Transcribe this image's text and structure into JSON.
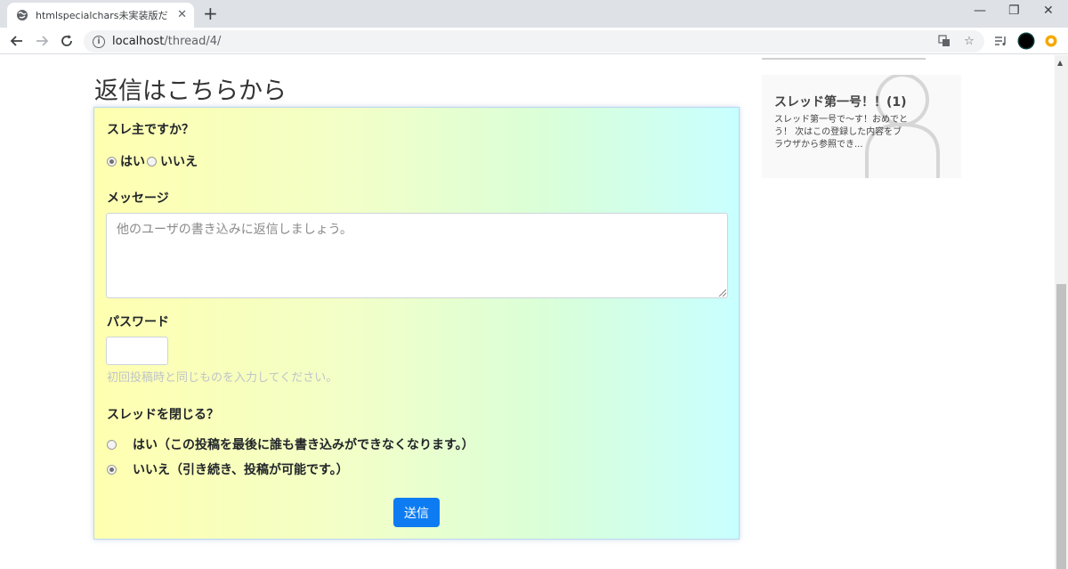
{
  "browser": {
    "tab_title": "htmlspecialchars未実装版だヒ",
    "url_host": "localhost",
    "url_path": "/thread/4/"
  },
  "page": {
    "heading": "返信はこちらから"
  },
  "form": {
    "owner_question": "スレ主ですか？",
    "owner_yes": "はい",
    "owner_no": "いいえ",
    "owner_selected": "yes",
    "message_label": "メッセージ",
    "message_placeholder": "他のユーザの書き込みに返信しましょう。",
    "password_label": "パスワード",
    "password_help": "初回投稿時と同じものを入力してください。",
    "close_question": "スレッドを閉じる？",
    "close_yes": "はい（この投稿を最後に誰も書き込みができなくなります。）",
    "close_no": "いいえ（引き続き、投稿が可能です。）",
    "close_selected": "no",
    "submit_label": "送信"
  },
  "sidebar": {
    "thread_title": "スレッド第一号！！(1)",
    "thread_snippet": "スレッド第一号で～す！おめでとう！ 次はこの登録した内容をブラウザから参照でき..."
  },
  "colors": {
    "accent": "#0d7cf2",
    "gradient_left": "#ffffb0",
    "gradient_right": "#c8ffff"
  }
}
